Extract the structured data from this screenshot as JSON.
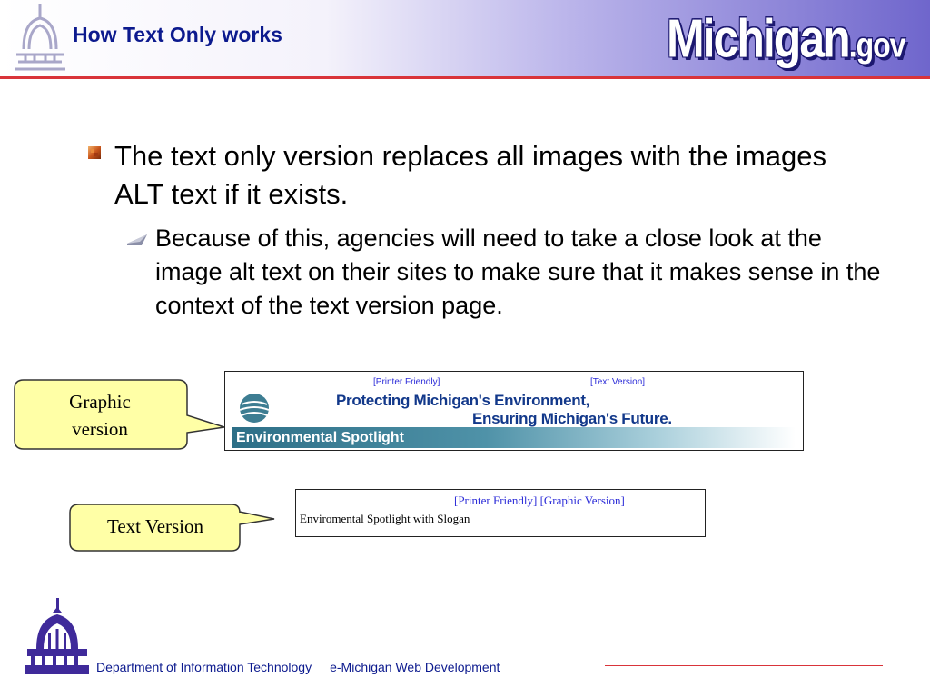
{
  "slide": {
    "title": "How Text Only works",
    "logo_word": "Michigan",
    "logo_tld": ".gov"
  },
  "content": {
    "bullet_1": "The text only version replaces all images with the images ALT text if it exists.",
    "bullet_2": "Because of this, agencies will need to take a close look at the image alt text on their sites to make sure that it makes sense in the context of the text version page."
  },
  "graphic_example": {
    "callout_line1": "Graphic",
    "callout_line2": "version",
    "link_printer": "[Printer Friendly]",
    "link_text_version": "[Text Version]",
    "slogan_line1": "Protecting Michigan's Environment,",
    "slogan_line2": "Ensuring Michigan's Future.",
    "banner": "Environmental Spotlight"
  },
  "text_example": {
    "callout": "Text Version",
    "links": "[Printer Friendly] [Graphic Version]",
    "content": "Enviromental Spotlight with Slogan"
  },
  "footer": {
    "department": "Department of Information Technology",
    "program": "e-Michigan Web Development"
  },
  "colors": {
    "title_blue": "#0c1a8e",
    "accent_red": "#d9343a",
    "callout_fill": "#ffffa6",
    "link_blue": "#2b2bd8"
  },
  "icons": {
    "header_logo": "capitol-dome-icon",
    "footer_logo": "michigan-dit-capitol-icon",
    "bullet_level1": "square-bullet-icon",
    "bullet_level2": "arrow-bullet-icon",
    "graphic_globe": "globe-icon"
  }
}
